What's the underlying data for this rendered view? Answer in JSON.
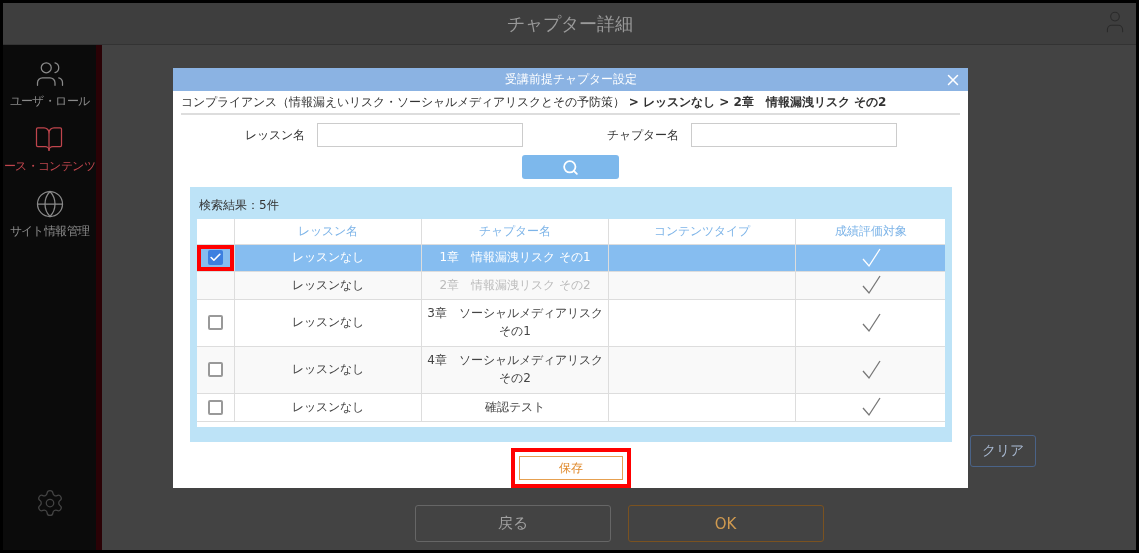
{
  "app": {
    "title": "チャプター詳細"
  },
  "sidebar": {
    "items": [
      {
        "label": "ユーザ・ロール",
        "selected": false
      },
      {
        "label": "ース・コンテンツ",
        "selected": true
      },
      {
        "label": "サイト情報管理",
        "selected": false
      }
    ]
  },
  "background_buttons": [
    {
      "label": "クリア",
      "kind": "clear"
    },
    {
      "label": "戻る",
      "kind": "back"
    },
    {
      "label": "OK",
      "kind": "ok"
    }
  ],
  "dialog": {
    "title": "受講前提チャプター設定",
    "breadcrumb": "コンプライアンス（情報漏えいリスク・ソーシャルメディアリスクとその予防策） **> レッスンなし > 2章　情報漏洩リスク その2**",
    "fields": [
      {
        "label": "レッスン名"
      },
      {
        "label": "チャプター名"
      }
    ],
    "result_count": "検索結果：5件",
    "table": {
      "columns": [
        "レッスン名",
        "チャプター名",
        "コンテンツタイプ",
        "成績評価対象"
      ],
      "rows": [
        {
          "selected": true,
          "checked": true,
          "disabled": false,
          "highlighted": true,
          "lesson": "レッスンなし",
          "chapter": "1章　情報漏洩リスク その1",
          "graded": true
        },
        {
          "selected": false,
          "disabled": true,
          "highlighted": false,
          "lesson": "レッスンなし",
          "chapter": "2章　情報漏洩リスク その2",
          "graded": true
        },
        {
          "selected": false,
          "checked": false,
          "disabled": false,
          "highlighted": false,
          "lesson": "レッスンなし",
          "chapter": "3章　ソーシャルメディアリスクその1",
          "graded": true
        },
        {
          "selected": false,
          "checked": false,
          "disabled": false,
          "highlighted": false,
          "lesson": "レッスンなし",
          "chapter": "4章　ソーシャルメディアリスクその2",
          "graded": true
        },
        {
          "selected": false,
          "checked": false,
          "disabled": false,
          "highlighted": false,
          "lesson": "レッスンなし",
          "chapter": "確認テスト",
          "graded": true
        }
      ]
    },
    "save_button": {
      "label": "保存",
      "highlighted": true
    }
  }
}
